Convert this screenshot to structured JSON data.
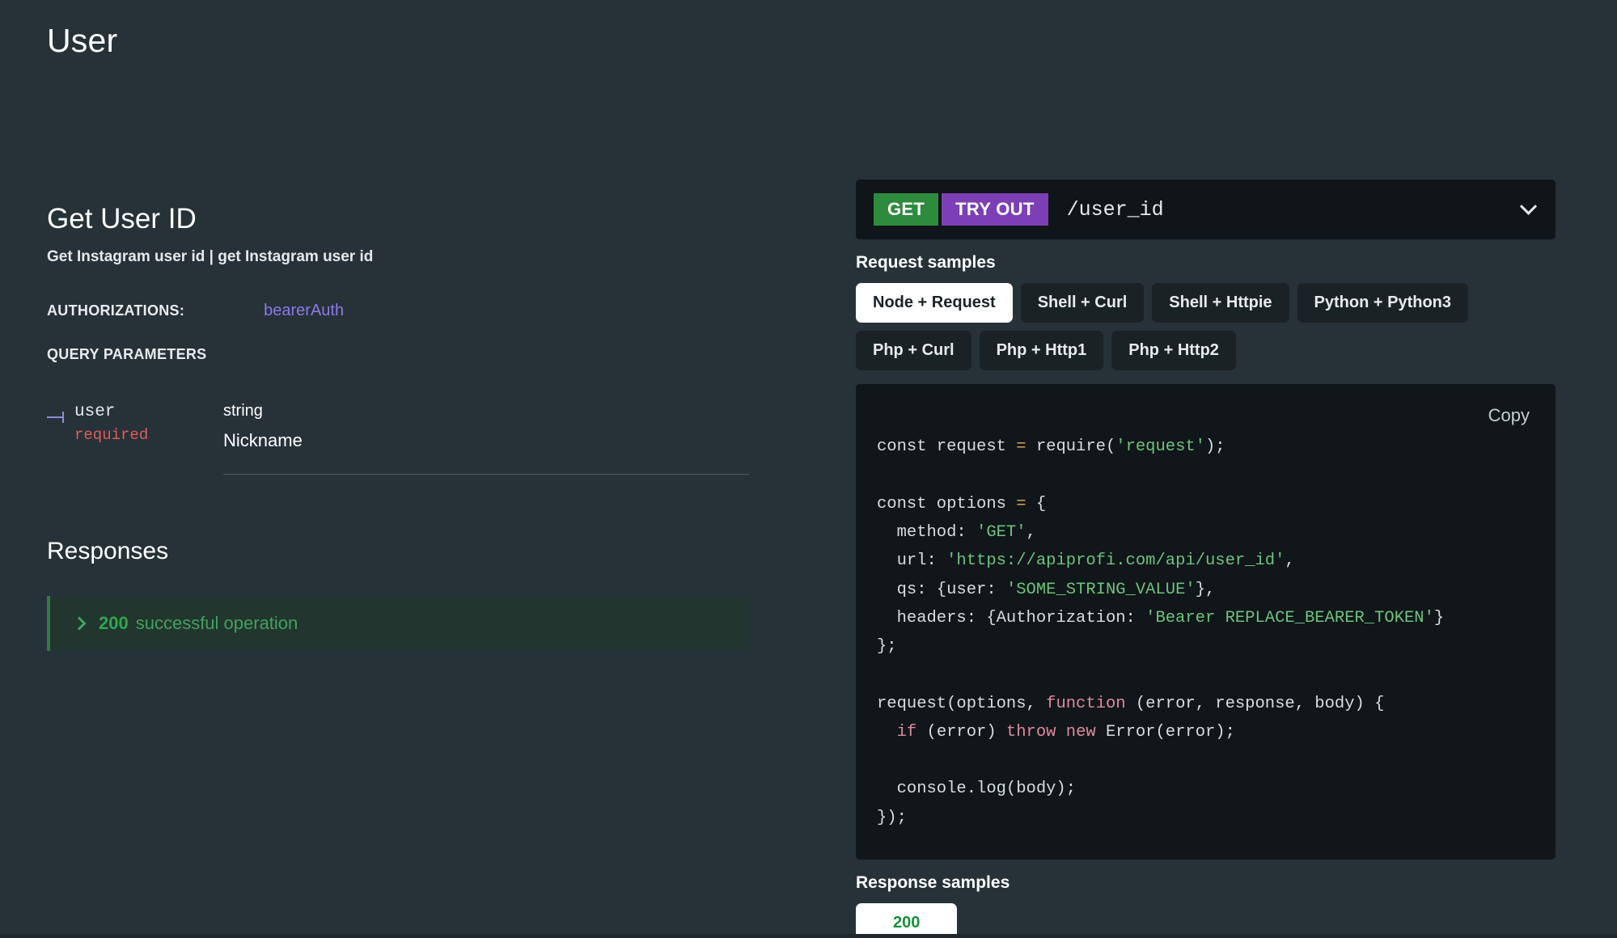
{
  "page": {
    "section_title": "User",
    "bg_color": "#263238"
  },
  "operation": {
    "title": "Get User ID",
    "description": "Get Instagram user id | get Instagram user id",
    "authorizations_label": "AUTHORIZATIONS:",
    "authorizations_value": "bearerAuth",
    "query_parameters_label": "QUERY PARAMETERS",
    "parameters": [
      {
        "name": "user",
        "required_label": "required",
        "type": "string",
        "title": "Nickname"
      }
    ]
  },
  "responses": {
    "heading": "Responses",
    "items": [
      {
        "code": "200",
        "text": "successful operation",
        "accent_color": "#2f7d46"
      }
    ]
  },
  "endpoint": {
    "method": "GET",
    "try_out_label": "TRY OUT",
    "path": "/user_id",
    "method_color": "#2e8b3d",
    "try_out_color": "#7d3fb5"
  },
  "request_samples": {
    "label": "Request samples",
    "tabs": [
      {
        "label": "Node + Request",
        "active": true
      },
      {
        "label": "Shell + Curl",
        "active": false
      },
      {
        "label": "Shell + Httpie",
        "active": false
      },
      {
        "label": "Python + Python3",
        "active": false
      },
      {
        "label": "Php + Curl",
        "active": false
      },
      {
        "label": "Php + Http1",
        "active": false
      },
      {
        "label": "Php + Http2",
        "active": false
      }
    ],
    "copy_label": "Copy",
    "code_lines": [
      "const request = require('request');",
      "",
      "const options = {",
      "  method: 'GET',",
      "  url: 'https://apiprofi.com/api/user_id',",
      "  qs: {user: 'SOME_STRING_VALUE'},",
      "  headers: {Authorization: 'Bearer REPLACE_BEARER_TOKEN'}",
      "};",
      "",
      "request(options, function (error, response, body) {",
      "  if (error) throw new Error(error);",
      "",
      "  console.log(body);",
      "});"
    ]
  },
  "response_samples": {
    "label": "Response samples",
    "tabs": [
      {
        "label": "200",
        "active": true
      }
    ]
  }
}
